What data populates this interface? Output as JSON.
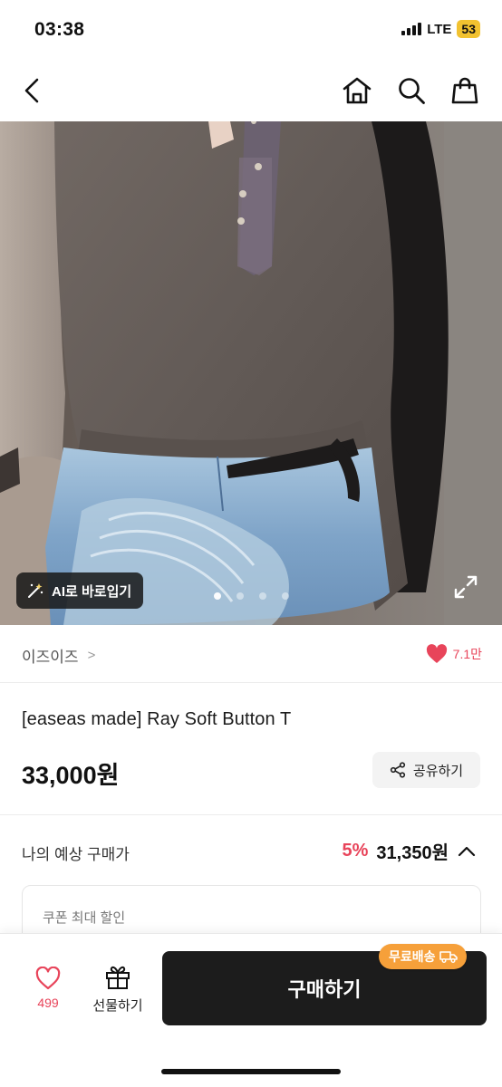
{
  "status_bar": {
    "time": "03:38",
    "network": "LTE",
    "battery": "53"
  },
  "nav": {
    "icons": [
      "back-icon",
      "home-icon",
      "search-icon",
      "shopping-bag-icon"
    ]
  },
  "hero": {
    "ai_chip_label": "AI로 바로입기",
    "carousel_page_count": 4,
    "carousel_active_index": 0
  },
  "brand": {
    "name": "이즈이즈",
    "chevron": ">",
    "like_count": "7.1만"
  },
  "product": {
    "title": "[easeas made] Ray Soft Button T",
    "price": "33,000원",
    "share_label": "공유하기"
  },
  "expected_price": {
    "label": "나의 예상 구매가",
    "discount": "5%",
    "price": "31,350원"
  },
  "coupon": {
    "label": "쿠폰 최대 할인"
  },
  "bottom_bar": {
    "wish_count": "499",
    "gift_label": "선물하기",
    "buy_label": "구매하기",
    "free_shipping_label": "무료배송"
  },
  "colors": {
    "accent_red": "#e8445a",
    "buy_button": "#1c1c1c",
    "free_shipping_badge": "#f6a03a",
    "battery": "#f2c230"
  }
}
